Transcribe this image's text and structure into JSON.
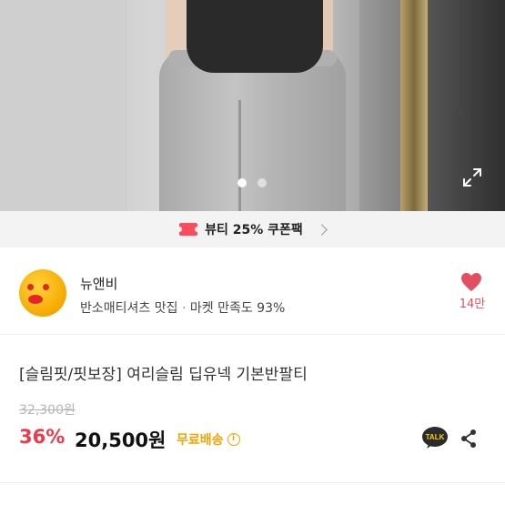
{
  "gallery": {
    "image_alt": "",
    "page_count": 2,
    "current_page": 1,
    "expand_icon": "expand-icon"
  },
  "coupon": {
    "icon": "coupon-ticket-icon",
    "label": "뷰티 25% 쿠폰팩",
    "chevron_icon": "chevron-right-icon"
  },
  "seller": {
    "avatar_icon": "seller-avatar",
    "name": "뉴앤비",
    "tagline": "반소매티셔츠 맛집",
    "separator": "·",
    "satisfaction": "마켓 만족도 93%",
    "likes_icon": "heart-icon",
    "likes": "14만"
  },
  "product": {
    "title": "[슬림핏/핏보장] 여리슬림 딥유넥 기본반팔티",
    "original_price": "32,300원",
    "discount": "36%",
    "price": "20,500원",
    "shipping": "무료배송",
    "shipping_info_icon": "info-icon",
    "talk_icon": "kakao-talk-icon",
    "talk_label": "TALK",
    "share_icon": "share-icon"
  },
  "colors": {
    "discount": "#f0384a",
    "shipping": "#f5a300",
    "heart": "#e34f61"
  }
}
